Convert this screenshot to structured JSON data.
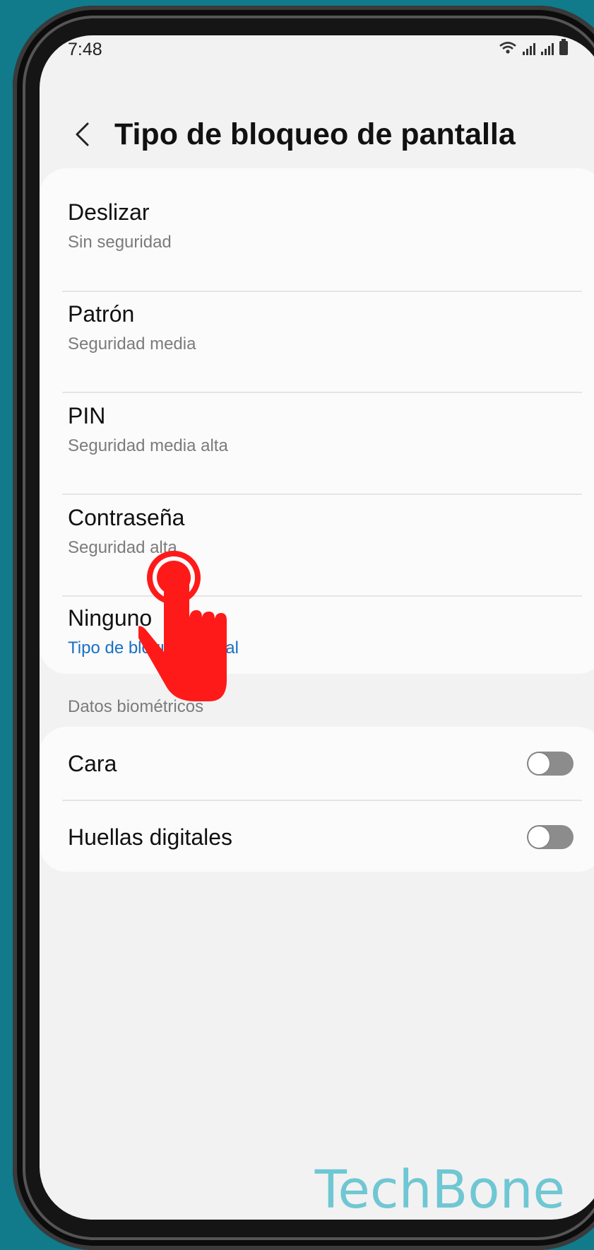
{
  "status_bar": {
    "time": "7:48"
  },
  "header": {
    "title": "Tipo de bloqueo de pantalla",
    "back_icon": "chevron-left-icon"
  },
  "lock_types": [
    {
      "title": "Deslizar",
      "subtitle": "Sin seguridad"
    },
    {
      "title": "Patrón",
      "subtitle": "Seguridad media"
    },
    {
      "title": "PIN",
      "subtitle": "Seguridad media alta"
    },
    {
      "title": "Contraseña",
      "subtitle": "Seguridad alta"
    },
    {
      "title": "Ninguno",
      "subtitle": "Tipo de bloqueo actual"
    }
  ],
  "biometrics": {
    "section_label": "Datos biométricos",
    "items": [
      {
        "label": "Cara",
        "enabled": false
      },
      {
        "label": "Huellas digitales",
        "enabled": false
      }
    ]
  },
  "overlay": {
    "icon": "tap-hand-icon",
    "color": "#ff1a1a"
  },
  "watermark": "TechBone",
  "colors": {
    "background": "#117a8b",
    "accent_link": "#1a6fc2",
    "toggle_off": "#8c8c8c"
  }
}
